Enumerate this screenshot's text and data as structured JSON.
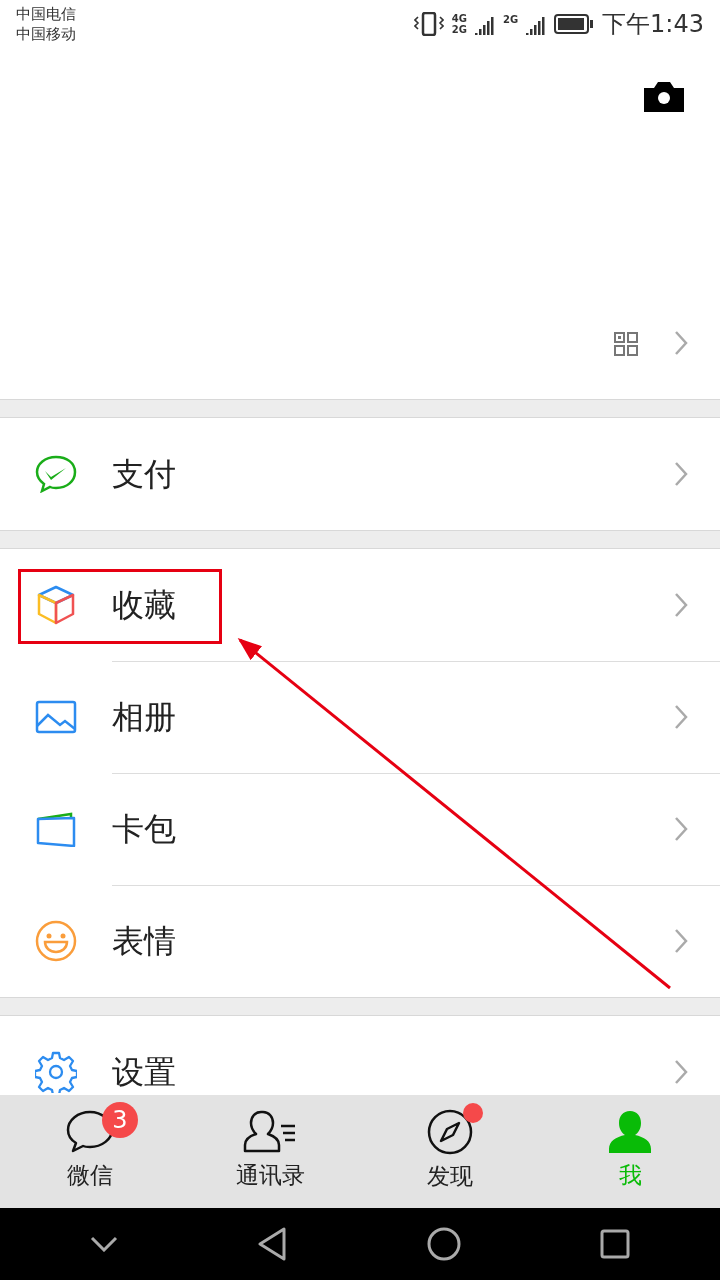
{
  "status_bar": {
    "carriers": [
      "中国电信",
      "中国移动"
    ],
    "network_labels": [
      "4G",
      "2G",
      "2G"
    ],
    "time": "下午1:43"
  },
  "groups": [
    {
      "items": [
        {
          "kind": "pay",
          "label": "支付",
          "highlighted": false
        }
      ]
    },
    {
      "items": [
        {
          "kind": "favorites",
          "label": "收藏",
          "highlighted": true
        },
        {
          "kind": "album",
          "label": "相册",
          "highlighted": false
        },
        {
          "kind": "cards",
          "label": "卡包",
          "highlighted": false
        },
        {
          "kind": "stickers",
          "label": "表情",
          "highlighted": false
        }
      ]
    },
    {
      "items": [
        {
          "kind": "settings",
          "label": "设置",
          "highlighted": false
        }
      ]
    }
  ],
  "tabs": [
    {
      "kind": "chats",
      "label": "微信",
      "badge": "3",
      "dot": false,
      "selected": false
    },
    {
      "kind": "contacts",
      "label": "通讯录",
      "dot": false,
      "selected": false
    },
    {
      "kind": "discover",
      "label": "发现",
      "dot": true,
      "selected": false
    },
    {
      "kind": "me",
      "label": "我",
      "dot": false,
      "selected": true
    }
  ]
}
